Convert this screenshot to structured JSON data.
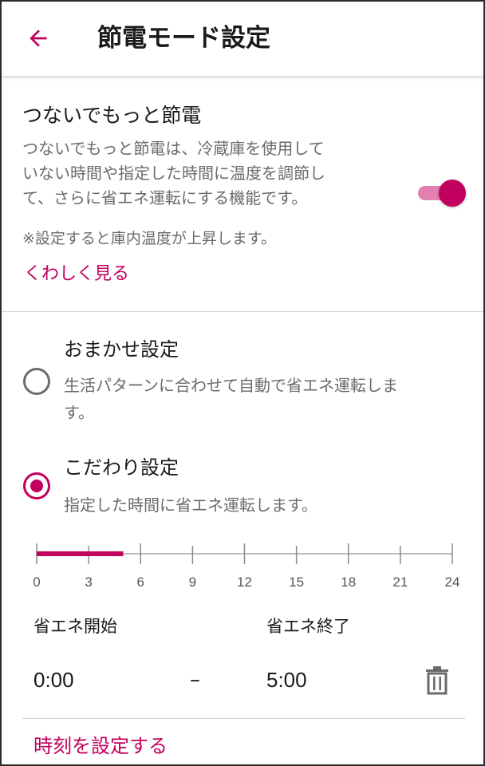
{
  "header": {
    "title": "節電モード設定",
    "back_icon": "arrow-left-icon"
  },
  "colors": {
    "accent": "#c2005e",
    "accent_light": "#e47fb2",
    "text": "#1a1a1a",
    "secondary_text": "#6b6b6b"
  },
  "feature": {
    "title": "つないでもっと節電",
    "description_lines": [
      "つないでもっと節電は、冷蔵庫を使用して",
      "いない時間や指定した時間に温度を調節し",
      "て、さらに省エネ運転にする機能です。"
    ],
    "note": "※設定すると庫内温度が上昇します。",
    "detail_link": "くわしく見る",
    "toggle_on": true
  },
  "options": [
    {
      "title": "おまかせ設定",
      "description_lines": [
        "生活パターンに合わせて自動で省エネ運転しま",
        "す。"
      ],
      "selected": false
    },
    {
      "title": "こだわり設定",
      "description_lines": [
        "指定した時間に省エネ運転します。"
      ],
      "selected": true
    }
  ],
  "timeline": {
    "ticks": [
      "0",
      "3",
      "6",
      "9",
      "12",
      "15",
      "18",
      "21",
      "24"
    ],
    "range_max": 24,
    "active_start": 0,
    "active_end": 5
  },
  "schedule": {
    "start_label": "省エネ開始",
    "end_label": "省エネ終了",
    "start_time": "0:00",
    "separator": "–",
    "end_time": "5:00",
    "delete_icon": "trash-icon"
  },
  "set_time_link": "時刻を設定する"
}
